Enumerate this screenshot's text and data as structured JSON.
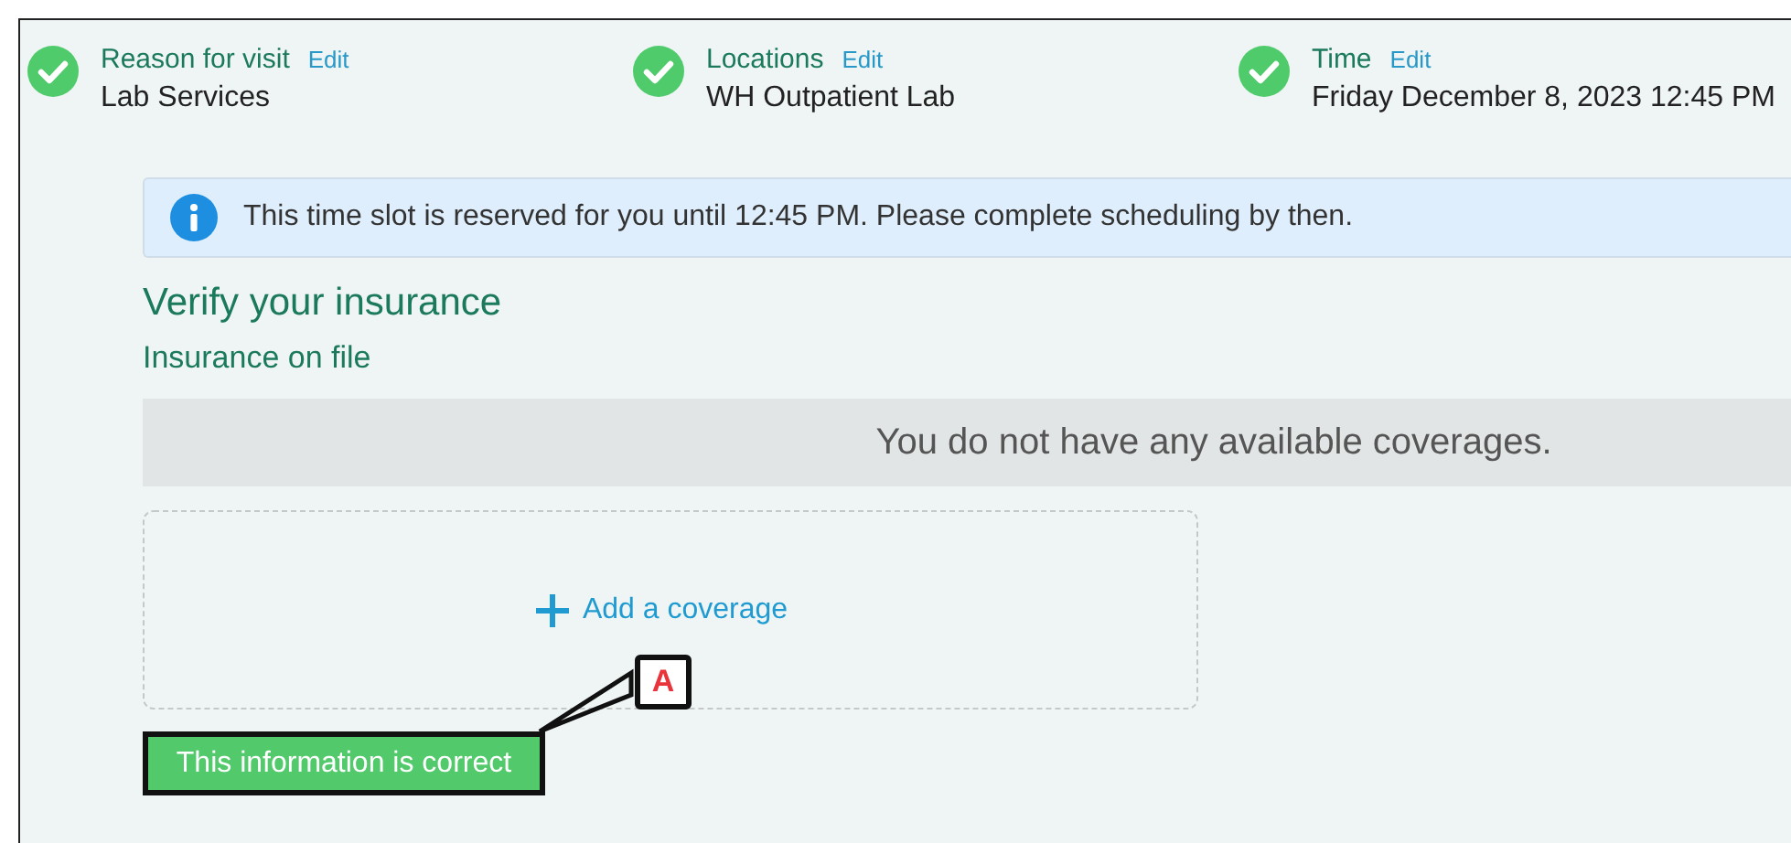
{
  "steps": [
    {
      "label": "Reason for visit",
      "edit": "Edit",
      "value": "Lab Services",
      "done": true
    },
    {
      "label": "Locations",
      "edit": "Edit",
      "value": "WH Outpatient Lab",
      "done": true
    },
    {
      "label": "Time",
      "edit": "Edit",
      "value": "Friday December 8, 2023 12:45 PM",
      "done": true
    }
  ],
  "notice": {
    "text": "This time slot is reserved for you until 12:45 PM. Please complete scheduling by then."
  },
  "heading": "Verify your insurance",
  "subheading": "Insurance on file",
  "empty_message": "You do not have any available coverages.",
  "add_coverage": {
    "label": "Add a coverage"
  },
  "confirm_button": {
    "label": "This information is correct"
  },
  "annotation": {
    "label": "A"
  }
}
